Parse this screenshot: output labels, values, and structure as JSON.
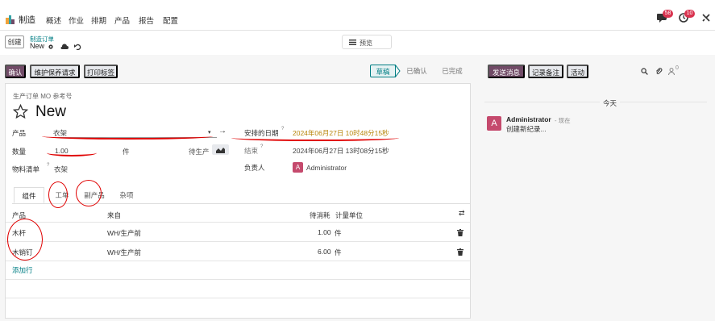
{
  "nav": {
    "app_name": "制造",
    "menu": [
      "概述",
      "作业",
      "排期",
      "产品",
      "报告",
      "配置"
    ],
    "chat_badge": "58",
    "activity_badge": "10"
  },
  "control": {
    "create_label": "创建",
    "breadcrumb_parent": "制造订单",
    "breadcrumb_current": "New",
    "view_label": "预览"
  },
  "actions": {
    "confirm": "确认",
    "maintenance": "维护保养请求",
    "print_labels": "打印标签",
    "stages": [
      "草稿",
      "已确认",
      "已完成"
    ]
  },
  "chatter": {
    "send_message": "发送消息",
    "log_note": "记录备注",
    "activity": "活动",
    "follower_count": "0",
    "date_separator": "今天",
    "author": "Administrator",
    "time": "- 现在",
    "avatar_letter": "A",
    "message": "创建新纪录..."
  },
  "form": {
    "ref_label": "生产订单 MO 参考号",
    "title": "New",
    "product_label": "产品",
    "product_value": "衣架",
    "qty_label": "数量",
    "qty_value": "1.00",
    "uom_value": "件",
    "to_produce": "待生产",
    "bom_label": "物料清单",
    "bom_value": "衣架",
    "scheduled_label": "安排的日期",
    "scheduled_value": "2024年06月27日 10时48分15秒",
    "end_label": "结束",
    "end_value": "2024年06月27日 13时08分15秒",
    "responsible_label": "负责人",
    "responsible_value": "Administrator",
    "responsible_letter": "A",
    "help_mark": "?",
    "tabs": [
      "组件",
      "工单",
      "副产品",
      "杂项"
    ]
  },
  "table": {
    "headers": {
      "product": "产品",
      "from": "来自",
      "to_consume": "待消耗",
      "uom": "计量单位"
    },
    "rows": [
      {
        "product": "木杆",
        "from": "WH/生产前",
        "qty": "1.00",
        "uom": "件"
      },
      {
        "product": "木销钉",
        "from": "WH/生产前",
        "qty": "6.00",
        "uom": "件"
      }
    ],
    "add_line": "添加行"
  }
}
